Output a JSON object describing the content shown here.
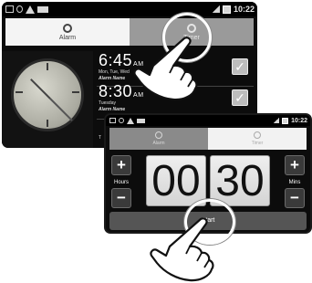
{
  "status_bar": {
    "time": "10:22"
  },
  "screen1": {
    "tabs": [
      {
        "label": "Alarm",
        "icon": "alarm-clock-icon",
        "state": "active"
      },
      {
        "label": "Timer",
        "icon": "timer-icon",
        "state": "inactive"
      }
    ],
    "alarms": [
      {
        "time": "6:45",
        "ampm": "AM",
        "days": "Mon, Tue, Wed",
        "name": "Alarm Name",
        "checked": "✓"
      },
      {
        "time": "8:30",
        "ampm": "AM",
        "days": "Tuesday",
        "name": "Alarm Name",
        "checked": "✓"
      },
      {
        "time": "",
        "ampm": "",
        "days": "T",
        "name": "",
        "checked": ""
      }
    ]
  },
  "screen2": {
    "tabs": [
      {
        "label": "Alarm",
        "icon": "alarm-clock-icon",
        "state": "inactive"
      },
      {
        "label": "Timer",
        "icon": "timer-icon",
        "state": "active"
      }
    ],
    "hours_label": "Hours",
    "mins_label": "Mins",
    "hours_value": "00",
    "mins_value": "30",
    "plus_symbol": "+",
    "minus_symbol": "−",
    "start_label": "Start"
  }
}
